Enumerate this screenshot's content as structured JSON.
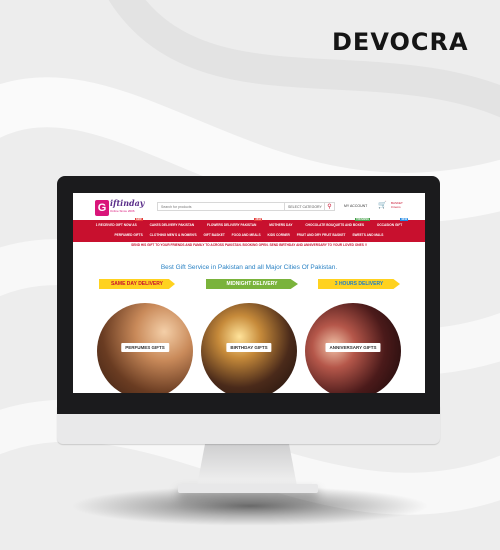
{
  "brand": "DEVOCRA",
  "site": {
    "logo_text": "iftinday",
    "logo_tag": "Online Since 2006",
    "search_placeholder": "Search for products",
    "category_select": "SELECT CATEGORY",
    "account_label": "MY ACCOUNT",
    "cart_title": "BASKET",
    "cart_items": "0 items",
    "nav_row1": [
      {
        "label": "1 RECEIVED GIFT NOW AS",
        "badge": "NEW"
      },
      {
        "label": "CAKES DELIVERY PAKISTAN",
        "badge": ""
      },
      {
        "label": "FLOWERS DELIVERY PAKISTAN",
        "badge": "NEW"
      },
      {
        "label": "MOTHERS DAY",
        "badge": ""
      },
      {
        "label": "CHOCOLATE BOUQUETS AND BOXES",
        "badge": "TRENDING"
      },
      {
        "label": "OCCASION GIFT",
        "badge": "NEW"
      }
    ],
    "nav_row2": [
      "PERFUMED GIFTS",
      "CLOTHING MEN'S & WOMEN'S",
      "GIFT BASKET",
      "FOOD AND MEALS",
      "KIDS CORNER",
      "FRUIT AND DRY FRUIT BASKET",
      "SWEETS AND MALS"
    ],
    "promo": "SEND HIS GIFT TO YOUR FRIENDS AND FAMILY TO ACROSS PAKISTAN. BOOKING OPEN. SEND BIRTHDAY AND ANNIVERSARY TO YOUR LOVED ONES !!",
    "headline": "Best Gift Service in Pakistan and all Major Cities Of Pakistan.",
    "ribbons": [
      "SAME DAY DELIVERY",
      "MIDNIGHT DELIVERY",
      "3 HOURS DELIVERY"
    ],
    "categories": [
      "PERFUMES GIFTS",
      "BIRTHDAY GIFTS",
      "ANNIVERSARY GIFTS"
    ]
  },
  "colors": {
    "accent": "#c8102e",
    "headline_blue": "#2a82c4",
    "ribbon_yellow": "#ffd21f",
    "ribbon_green": "#7ab33b"
  }
}
